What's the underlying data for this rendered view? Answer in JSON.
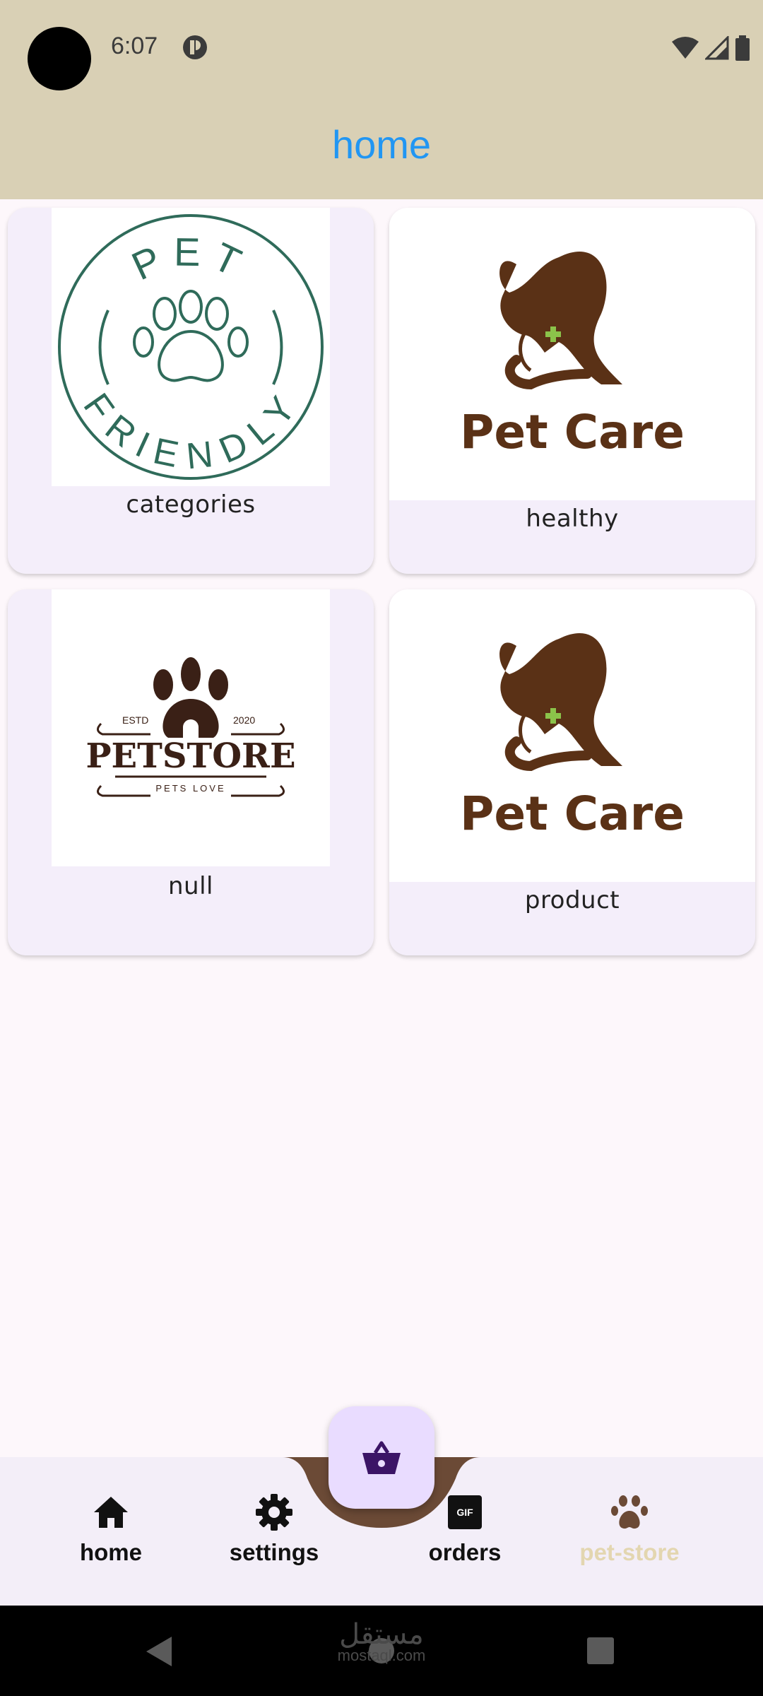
{
  "status_bar": {
    "time": "6:07"
  },
  "app_bar": {
    "title": "home"
  },
  "grid": [
    {
      "label": "categories",
      "image": "pet-friendly-logo",
      "logo_top": "PET",
      "logo_bottom": "FRIENDLY"
    },
    {
      "label": "healthy",
      "image": "pet-care-logo",
      "logo_text": "Pet Care"
    },
    {
      "label": "null",
      "image": "petstore-logo",
      "logo_text": "PETSTORE",
      "estd": "ESTD",
      "year": "2020",
      "tagline": "PETS LOVE"
    },
    {
      "label": "product",
      "image": "pet-care-logo",
      "logo_text": "Pet Care"
    }
  ],
  "bottom_nav": {
    "items": [
      {
        "label": "home",
        "icon": "home-icon"
      },
      {
        "label": "settings",
        "icon": "gear-icon"
      },
      {
        "label": "orders",
        "icon": "gif-icon",
        "icon_text": "GIF"
      },
      {
        "label": "pet-store",
        "icon": "paw-icon",
        "active": true
      }
    ],
    "fab_icon": "basket-icon"
  },
  "watermark": {
    "text": "مستقل",
    "sub": "mostaql.com"
  },
  "colors": {
    "app_bar": "#d9d0b5",
    "title": "#2196f3",
    "card_bg": "#f4eefa",
    "brown": "#5a3116",
    "pet_friendly_green": "#2f6b5a",
    "nav_active": "#e3d6b0",
    "fab_bg": "#e9dcff",
    "fab_icon": "#3b1466"
  }
}
